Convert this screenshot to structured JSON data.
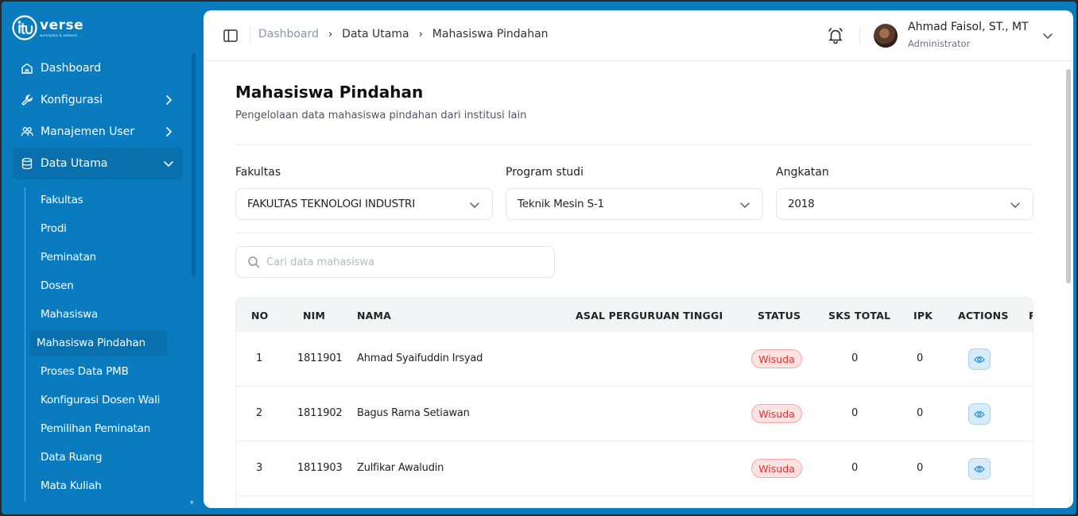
{
  "brand": {
    "name": "verse",
    "tagline": "workspace & network"
  },
  "sidebar": {
    "items": [
      {
        "label": "Dashboard",
        "icon": "home-icon"
      },
      {
        "label": "Konfigurasi",
        "icon": "wrench-icon"
      },
      {
        "label": "Manajemen User",
        "icon": "users-icon"
      },
      {
        "label": "Data Utama",
        "icon": "database-icon"
      }
    ],
    "submenu": [
      "Fakultas",
      "Prodi",
      "Peminatan",
      "Dosen",
      "Mahasiswa",
      "Mahasiswa Pindahan",
      "Proses Data PMB",
      "Konfigurasi Dosen Wali",
      "Pemilihan Peminatan",
      "Data Ruang",
      "Mata Kuliah"
    ]
  },
  "breadcrumb": [
    "Dashboard",
    "Data Utama",
    "Mahasiswa Pindahan"
  ],
  "user": {
    "name": "Ahmad Faisol, ST., MT",
    "role": "Administrator"
  },
  "page": {
    "title": "Mahasiswa Pindahan",
    "subtitle": "Pengelolaan data mahasiswa pindahan dari institusi lain"
  },
  "filters": {
    "fakultas": {
      "label": "Fakultas",
      "value": "FAKULTAS TEKNOLOGI INDUSTRI"
    },
    "prodi": {
      "label": "Program studi",
      "value": "Teknik Mesin S-1"
    },
    "angkatan": {
      "label": "Angkatan",
      "value": "2018"
    }
  },
  "search": {
    "placeholder": "Cari data mahasiswa"
  },
  "table": {
    "headers": [
      "NO",
      "NIM",
      "NAMA",
      "ASAL PERGURUAN TINGGI",
      "STATUS",
      "SKS TOTAL",
      "IPK",
      "ACTIONS",
      "R"
    ],
    "rows": [
      {
        "no": "1",
        "nim": "1811901",
        "nama": "Ahmad Syaifuddin Irsyad",
        "asal": "",
        "status": "Wisuda",
        "sks": "0",
        "ipk": "0"
      },
      {
        "no": "2",
        "nim": "1811902",
        "nama": "Bagus Rama Setiawan",
        "asal": "",
        "status": "Wisuda",
        "sks": "0",
        "ipk": "0"
      },
      {
        "no": "3",
        "nim": "1811903",
        "nama": "Zulfikar Awaludin",
        "asal": "",
        "status": "Wisuda",
        "sks": "0",
        "ipk": "0"
      }
    ]
  },
  "colors": {
    "sidebar": "#0a7bbf",
    "badge_text": "#e03131",
    "badge_bg": "#fde2e2",
    "action_bg": "#d7ecfb"
  }
}
